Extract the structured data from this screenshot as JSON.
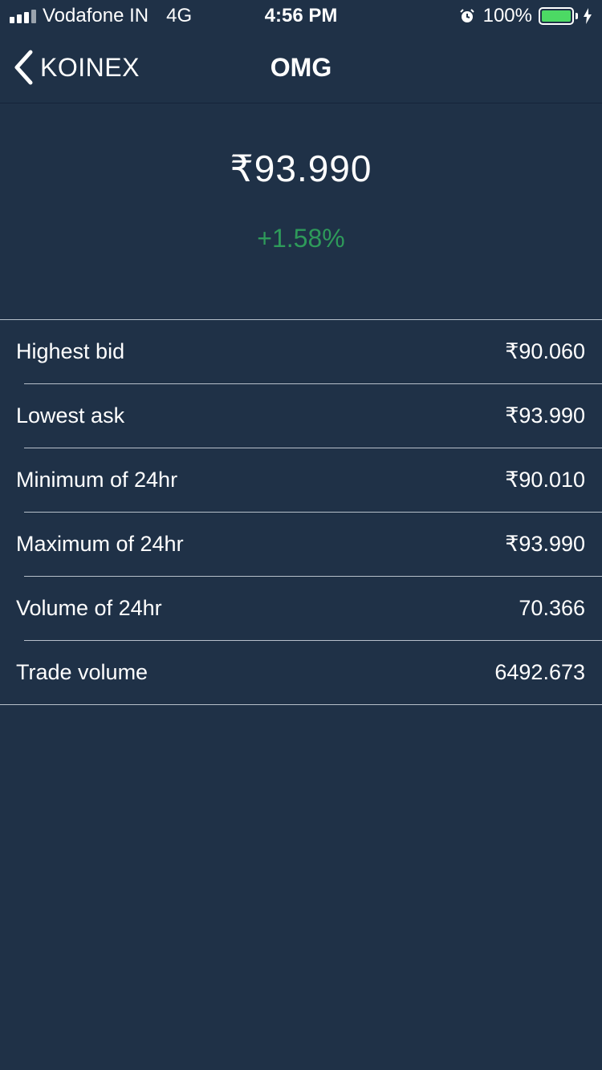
{
  "status_bar": {
    "carrier": "Vodafone IN",
    "network": "4G",
    "time": "4:56 PM",
    "battery": "100%",
    "icons": [
      "signal-icon",
      "alarm-icon",
      "battery-icon",
      "charging-bolt-icon"
    ]
  },
  "nav": {
    "back_label": "KOINEX",
    "title": "OMG",
    "back_icon": "chevron-left-icon"
  },
  "summary": {
    "price": "₹93.990",
    "change": "+1.58%",
    "change_color": "#2e9a5a"
  },
  "stats": [
    {
      "label": "Highest bid",
      "value": "₹90.060"
    },
    {
      "label": "Lowest ask",
      "value": "₹93.990"
    },
    {
      "label": "Minimum of 24hr",
      "value": "₹90.010"
    },
    {
      "label": "Maximum of 24hr",
      "value": "₹93.990"
    },
    {
      "label": "Volume of 24hr",
      "value": "70.366"
    },
    {
      "label": "Trade volume",
      "value": "6492.673"
    }
  ],
  "colors": {
    "background": "#1f3147",
    "divider": "#b7c0cb",
    "positive": "#2e9a5a"
  }
}
